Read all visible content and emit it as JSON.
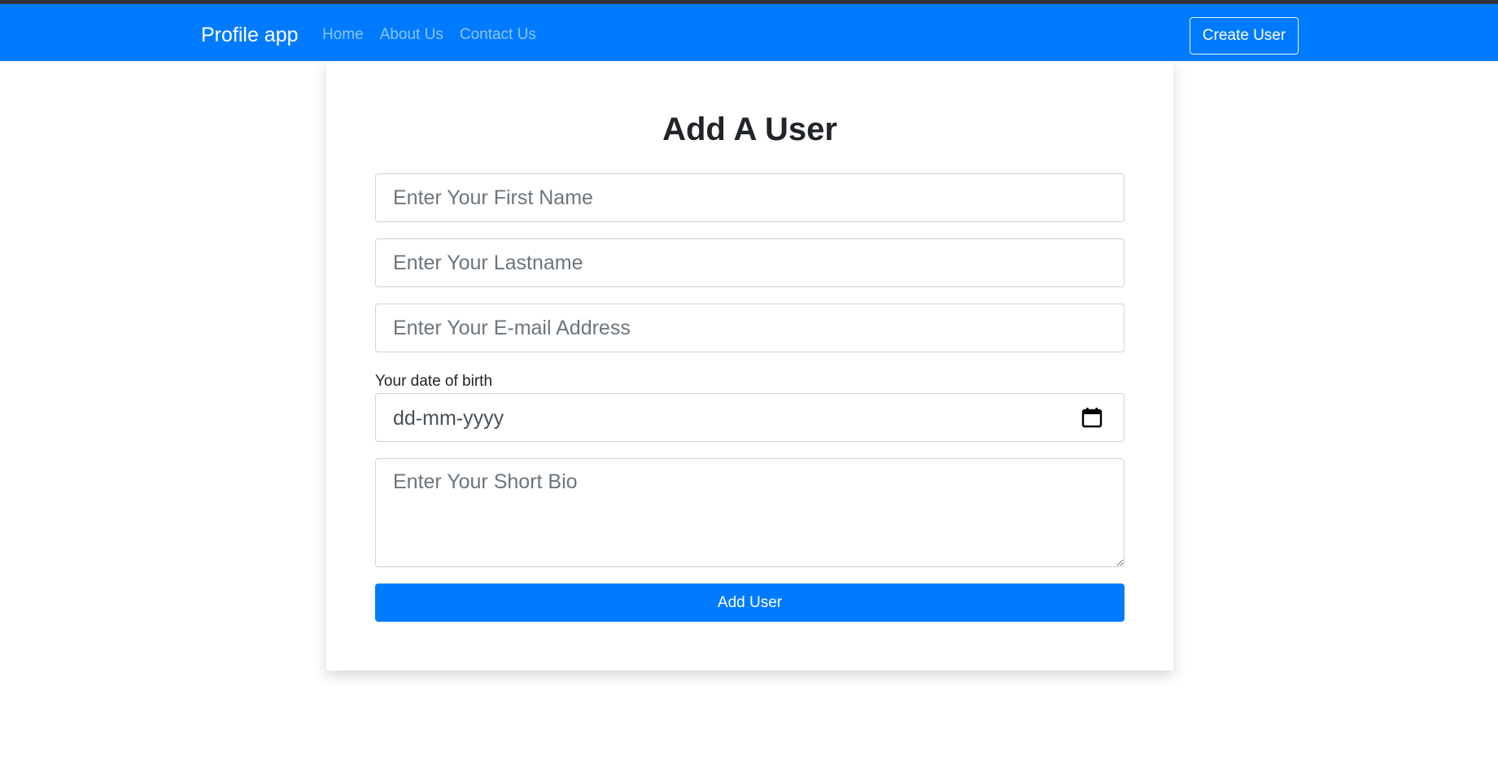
{
  "navbar": {
    "brand": "Profile app",
    "links": [
      {
        "label": "Home"
      },
      {
        "label": "About Us"
      },
      {
        "label": "Contact Us"
      }
    ],
    "create_button": "Create User",
    "background_color": "#007bff"
  },
  "form": {
    "title": "Add A User",
    "first_name_placeholder": "Enter Your First Name",
    "last_name_placeholder": "Enter Your Lastname",
    "email_placeholder": "Enter Your E-mail Address",
    "dob_label": "Your date of birth",
    "dob_placeholder": "dd-mm-yyyy",
    "dob_icon": "calendar-icon",
    "bio_placeholder": "Enter Your Short Bio",
    "submit_label": "Add User"
  }
}
